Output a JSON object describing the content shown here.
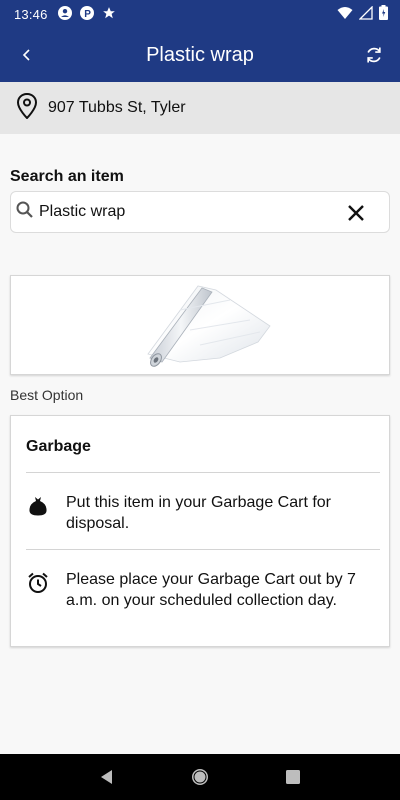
{
  "status_bar": {
    "time": "13:46",
    "left_icons": [
      "account-circle-icon",
      "parking-icon",
      "star-icon"
    ],
    "right_icons": [
      "wifi-icon",
      "signal-icon",
      "battery-icon"
    ]
  },
  "app_bar": {
    "title": "Plastic wrap",
    "color": "#1f3a84"
  },
  "address": {
    "text": "907 Tubbs St, Tyler"
  },
  "search": {
    "label": "Search an item",
    "value": "Plastic wrap"
  },
  "item_image": {
    "alt": "Plastic wrap roll"
  },
  "best_option": {
    "label": "Best Option",
    "card": {
      "title": "Garbage",
      "rows": [
        {
          "icon": "garbage-bag-icon",
          "text": "Put this item in your Garbage Cart for disposal."
        },
        {
          "icon": "alarm-clock-icon",
          "text": "Please place your Garbage Cart out by 7 a.m. on your scheduled collection day."
        }
      ]
    }
  },
  "nav_bar": {
    "buttons": [
      "back-triangle-icon",
      "home-circle-icon",
      "recents-square-icon"
    ]
  }
}
